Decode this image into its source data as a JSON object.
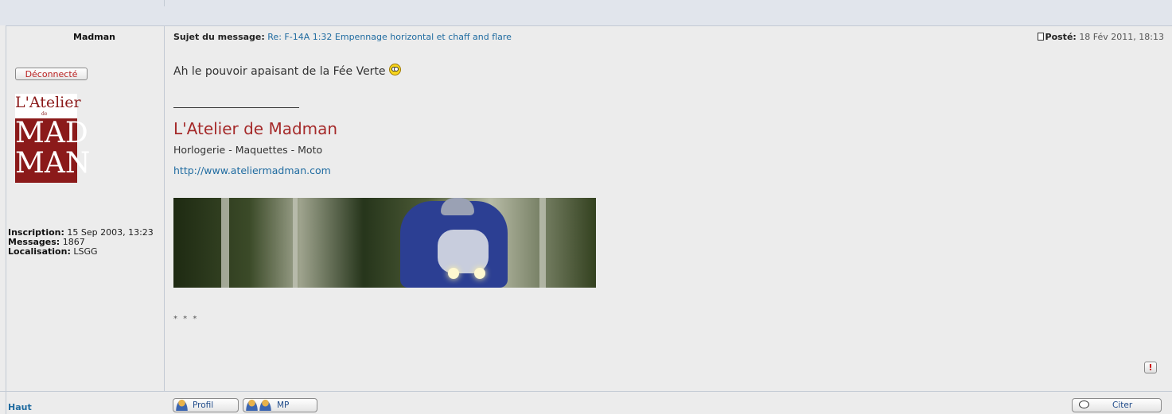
{
  "post": {
    "author": "Madman",
    "status_badge": "Déconnecté",
    "avatar_text": {
      "line1": "L'Atelier",
      "line2": "de",
      "line3": "MAD MAN"
    },
    "profile": {
      "inscription_label": "Inscription:",
      "inscription_value": "15 Sep 2003, 13:23",
      "messages_label": "Messages:",
      "messages_value": "1867",
      "localisation_label": "Localisation:",
      "localisation_value": "LSGG"
    },
    "subject_label": "Sujet du message:",
    "subject_value": "Re: F-14A 1:32 Empennage horizontal et chaff and flare",
    "posted_label": "Posté:",
    "posted_value": "18 Fév 2011, 18:13",
    "message_text": "Ah le pouvoir apaisant de la Fée Verte",
    "smiley_icon": "eyes-rolling-smiley-icon",
    "signature": {
      "title": "L'Atelier de Madman",
      "subtitle": "Horlogerie - Maquettes - Moto",
      "link": "http://www.ateliermadman.com",
      "footer": "* * *"
    }
  },
  "actions": {
    "top_link": "Haut",
    "profile_button": "Profil",
    "pm_button": "MP",
    "quote_button": "Citer",
    "report_icon": "report-exclamation-icon"
  },
  "colors": {
    "link": "#1F6BA0",
    "signature_title": "#A52A2A",
    "offline": "#BB2222",
    "background": "#ECECEC"
  }
}
